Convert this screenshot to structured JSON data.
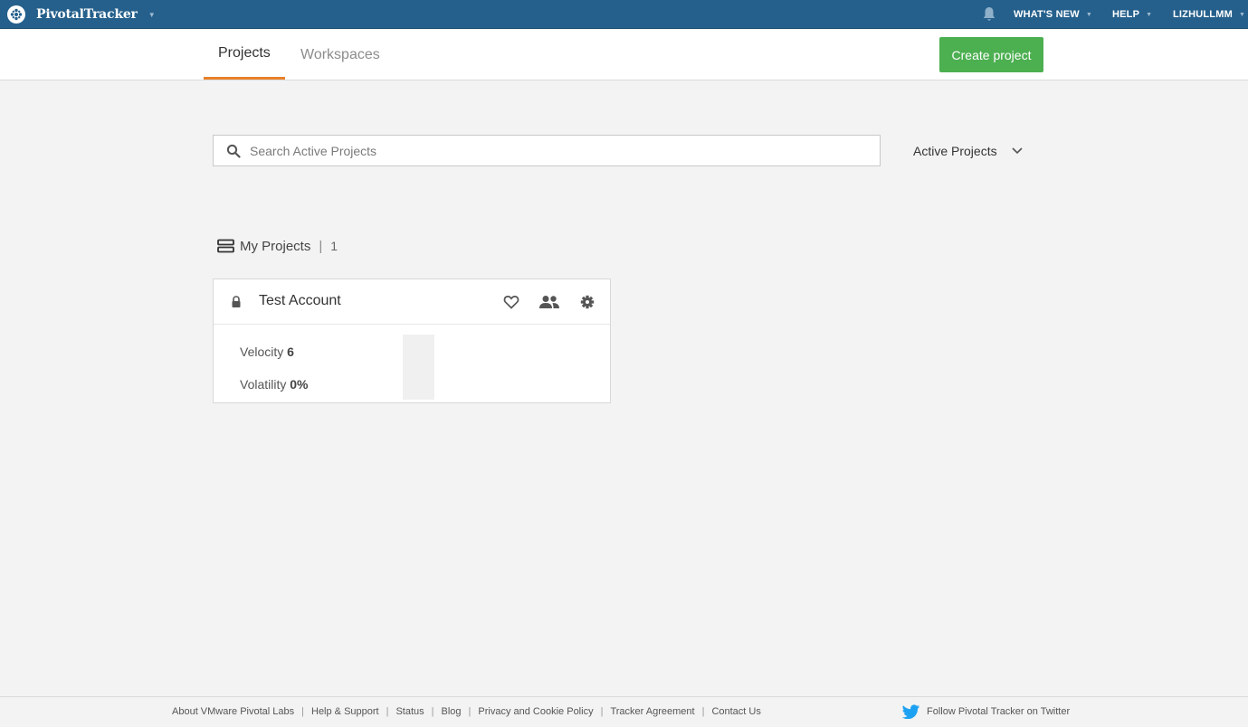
{
  "topbar": {
    "brand": "PivotalTracker",
    "nav": {
      "whats_new": "WHAT'S NEW",
      "help": "HELP",
      "user": "LIZHULLMM"
    }
  },
  "tabs": [
    {
      "label": "Projects",
      "active": true
    },
    {
      "label": "Workspaces",
      "active": false
    }
  ],
  "create_button": "Create project",
  "search": {
    "placeholder": "Search Active Projects",
    "value": ""
  },
  "filter": {
    "selected": "Active Projects"
  },
  "group": {
    "title": "My Projects",
    "separator": "|",
    "count": "1"
  },
  "project": {
    "name": "Test Account",
    "velocity_label": "Velocity",
    "velocity_value": "6",
    "volatility_label": "Volatility",
    "volatility_value": "0%"
  },
  "footer": {
    "links": [
      "About VMware Pivotal Labs",
      "Help & Support",
      "Status",
      "Blog",
      "Privacy and Cookie Policy",
      "Tracker Agreement",
      "Contact Us"
    ],
    "separator": "|",
    "twitter": "Follow Pivotal Tracker on Twitter"
  },
  "colors": {
    "topbar": "#25608c",
    "accent_tab": "#e8802a",
    "create_button": "#4caf50",
    "twitter": "#1da1f2"
  }
}
